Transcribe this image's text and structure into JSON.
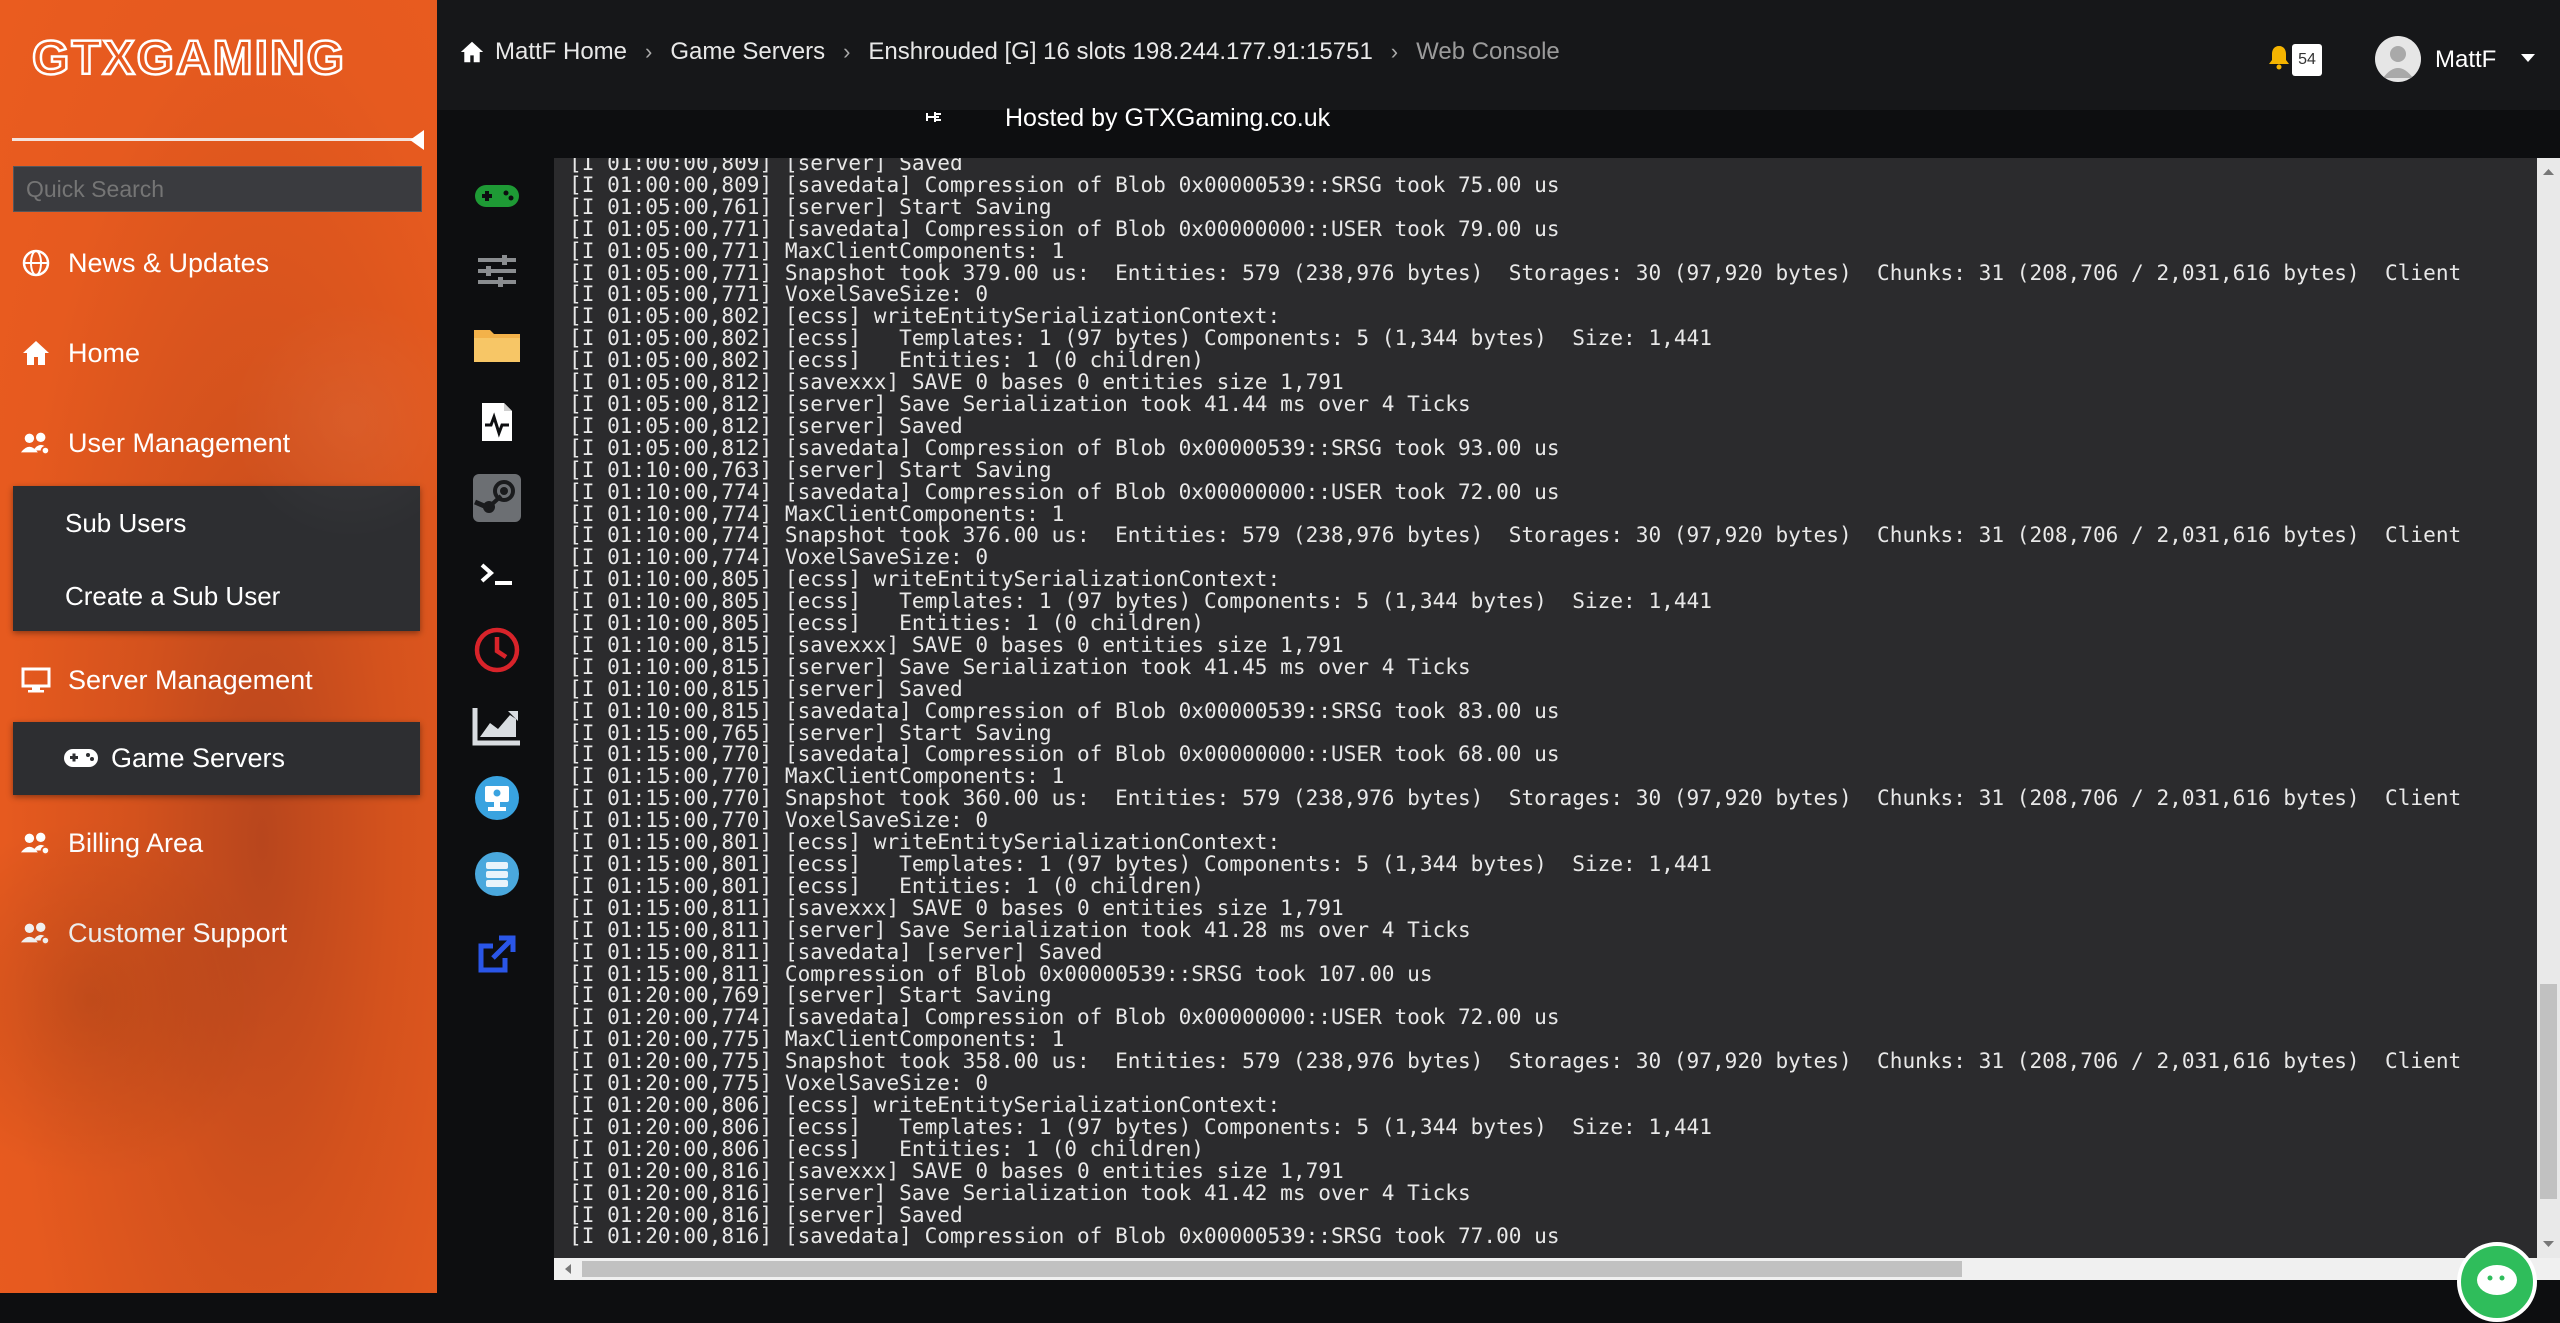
{
  "sidebar": {
    "logo_text": "GTXGAMING",
    "search_placeholder": "Quick Search",
    "items": {
      "news": "News & Updates",
      "home": "Home",
      "user_management": "User Management",
      "sub_users": "Sub Users",
      "create_sub_user": "Create a Sub User",
      "server_management": "Server Management",
      "game_servers": "Game Servers",
      "billing": "Billing Area",
      "support": "Customer Support"
    }
  },
  "breadcrumb": {
    "home": "MattF Home",
    "game_servers": "Game Servers",
    "server": "Enshrouded [G] 16 slots 198.244.177.91:15751",
    "current": "Web Console"
  },
  "header": {
    "notification_count": "54",
    "username": "MattF",
    "hosted_by": "Hosted by GTXGaming.co.uk"
  },
  "rail_icons": [
    "gamepad-icon",
    "sliders-icon",
    "folder-icon",
    "file-pulse-icon",
    "steam-icon",
    "terminal-icon",
    "clock-icon",
    "chart-icon",
    "monitor-icon",
    "database-icon",
    "external-link-icon"
  ],
  "console": {
    "lines": [
      "[I 01:00:00,809] [server] Saved",
      "[I 01:00:00,809] [savedata] Compression of Blob 0x00000539::SRSG took 75.00 us",
      "[I 01:05:00,761] [server] Start Saving",
      "[I 01:05:00,771] [savedata] Compression of Blob 0x00000000::USER took 79.00 us",
      "[I 01:05:00,771] MaxClientComponents: 1",
      "[I 01:05:00,771] Snapshot took 379.00 us:  Entities: 579 (238,976 bytes)  Storages: 30 (97,920 bytes)  Chunks: 31 (208,706 / 2,031,616 bytes)  Client",
      "[I 01:05:00,771] VoxelSaveSize: 0",
      "[I 01:05:00,802] [ecss] writeEntitySerializationContext:",
      "[I 01:05:00,802] [ecss]   Templates: 1 (97 bytes) Components: 5 (1,344 bytes)  Size: 1,441",
      "[I 01:05:00,802] [ecss]   Entities: 1 (0 children)",
      "[I 01:05:00,812] [savexxx] SAVE 0 bases 0 entities size 1,791",
      "[I 01:05:00,812] [server] Save Serialization took 41.44 ms over 4 Ticks",
      "[I 01:05:00,812] [server] Saved",
      "[I 01:05:00,812] [savedata] Compression of Blob 0x00000539::SRSG took 93.00 us",
      "[I 01:10:00,763] [server] Start Saving",
      "[I 01:10:00,774] [savedata] Compression of Blob 0x00000000::USER took 72.00 us",
      "[I 01:10:00,774] MaxClientComponents: 1",
      "[I 01:10:00,774] Snapshot took 376.00 us:  Entities: 579 (238,976 bytes)  Storages: 30 (97,920 bytes)  Chunks: 31 (208,706 / 2,031,616 bytes)  Client",
      "[I 01:10:00,774] VoxelSaveSize: 0",
      "[I 01:10:00,805] [ecss] writeEntitySerializationContext:",
      "[I 01:10:00,805] [ecss]   Templates: 1 (97 bytes) Components: 5 (1,344 bytes)  Size: 1,441",
      "[I 01:10:00,805] [ecss]   Entities: 1 (0 children)",
      "[I 01:10:00,815] [savexxx] SAVE 0 bases 0 entities size 1,791",
      "[I 01:10:00,815] [server] Save Serialization took 41.45 ms over 4 Ticks",
      "[I 01:10:00,815] [server] Saved",
      "[I 01:10:00,815] [savedata] Compression of Blob 0x00000539::SRSG took 83.00 us",
      "[I 01:15:00,765] [server] Start Saving",
      "[I 01:15:00,770] [savedata] Compression of Blob 0x00000000::USER took 68.00 us",
      "[I 01:15:00,770] MaxClientComponents: 1",
      "[I 01:15:00,770] Snapshot took 360.00 us:  Entities: 579 (238,976 bytes)  Storages: 30 (97,920 bytes)  Chunks: 31 (208,706 / 2,031,616 bytes)  Client",
      "[I 01:15:00,770] VoxelSaveSize: 0",
      "[I 01:15:00,801] [ecss] writeEntitySerializationContext:",
      "[I 01:15:00,801] [ecss]   Templates: 1 (97 bytes) Components: 5 (1,344 bytes)  Size: 1,441",
      "[I 01:15:00,801] [ecss]   Entities: 1 (0 children)",
      "[I 01:15:00,811] [savexxx] SAVE 0 bases 0 entities size 1,791",
      "[I 01:15:00,811] [server] Save Serialization took 41.28 ms over 4 Ticks",
      "[I 01:15:00,811] [savedata] [server] Saved",
      "[I 01:15:00,811] Compression of Blob 0x00000539::SRSG took 107.00 us",
      "[I 01:20:00,769] [server] Start Saving",
      "[I 01:20:00,774] [savedata] Compression of Blob 0x00000000::USER took 72.00 us",
      "[I 01:20:00,775] MaxClientComponents: 1",
      "[I 01:20:00,775] Snapshot took 358.00 us:  Entities: 579 (238,976 bytes)  Storages: 30 (97,920 bytes)  Chunks: 31 (208,706 / 2,031,616 bytes)  Client",
      "[I 01:20:00,775] VoxelSaveSize: 0",
      "[I 01:20:00,806] [ecss] writeEntitySerializationContext:",
      "[I 01:20:00,806] [ecss]   Templates: 1 (97 bytes) Components: 5 (1,344 bytes)  Size: 1,441",
      "[I 01:20:00,806] [ecss]   Entities: 1 (0 children)",
      "[I 01:20:00,816] [savexxx] SAVE 0 bases 0 entities size 1,791",
      "[I 01:20:00,816] [server] Save Serialization took 41.42 ms over 4 Ticks",
      "[I 01:20:00,816] [server] Saved",
      "[I 01:20:00,816] [savedata] Compression of Blob 0x00000539::SRSG took 77.00 us"
    ]
  },
  "colors": {
    "sidebar_orange": "#e65a1f",
    "console_bg": "#2b2b2d",
    "topbar_bg": "#161719",
    "bell": "#f5b400"
  }
}
